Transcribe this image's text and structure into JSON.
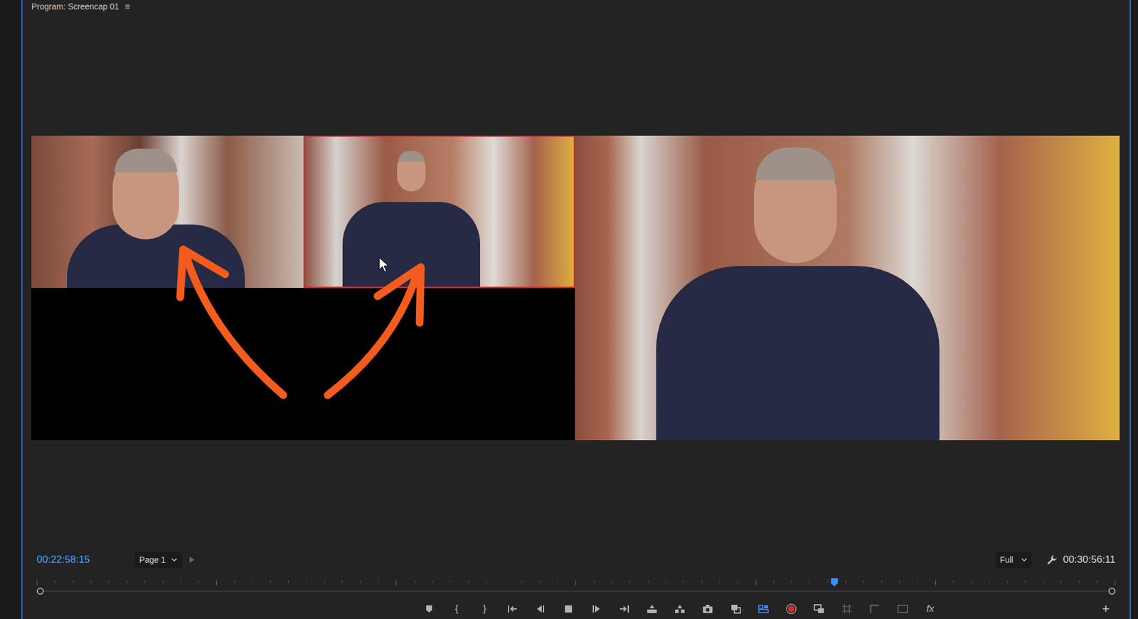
{
  "panel": {
    "title": "Program: Screencap 01",
    "menu_icon": "≡"
  },
  "multicam": {
    "angles": [
      {
        "kind": "video",
        "selected": false
      },
      {
        "kind": "video",
        "selected": true
      },
      {
        "kind": "empty",
        "selected": false
      },
      {
        "kind": "empty",
        "selected": false
      }
    ]
  },
  "timecode": "00:22:58:15",
  "page_select": {
    "label": "Page 1"
  },
  "zoom_select": {
    "label": "Full"
  },
  "duration": "00:30:56:11",
  "scrubber": {
    "level": 0.741
  },
  "controls": [
    {
      "kind": "marker",
      "active": false,
      "disabled": false
    },
    {
      "kind": "text",
      "label": "{",
      "active": false,
      "disabled": false
    },
    {
      "kind": "text",
      "label": "}",
      "active": false,
      "disabled": false
    },
    {
      "kind": "go-to-in",
      "active": false,
      "disabled": false
    },
    {
      "kind": "step-back",
      "active": false,
      "disabled": false
    },
    {
      "kind": "stop",
      "active": false,
      "disabled": false
    },
    {
      "kind": "step-forward",
      "active": false,
      "disabled": false
    },
    {
      "kind": "go-to-out",
      "active": false,
      "disabled": false
    },
    {
      "kind": "lift",
      "active": false,
      "disabled": false
    },
    {
      "kind": "extract",
      "active": false,
      "disabled": false
    },
    {
      "kind": "camera",
      "active": false,
      "disabled": false
    },
    {
      "kind": "compare",
      "active": false,
      "disabled": false
    },
    {
      "kind": "multicam",
      "active": true,
      "disabled": false
    },
    {
      "kind": "record",
      "active": false,
      "disabled": false
    },
    {
      "kind": "proxy",
      "active": false,
      "disabled": false
    },
    {
      "kind": "grid",
      "active": false,
      "disabled": true
    },
    {
      "kind": "corner",
      "active": false,
      "disabled": true
    },
    {
      "kind": "overlay",
      "active": false,
      "disabled": true
    },
    {
      "kind": "text",
      "label": "fx",
      "active": false,
      "disabled": false
    }
  ],
  "add_button": "+"
}
